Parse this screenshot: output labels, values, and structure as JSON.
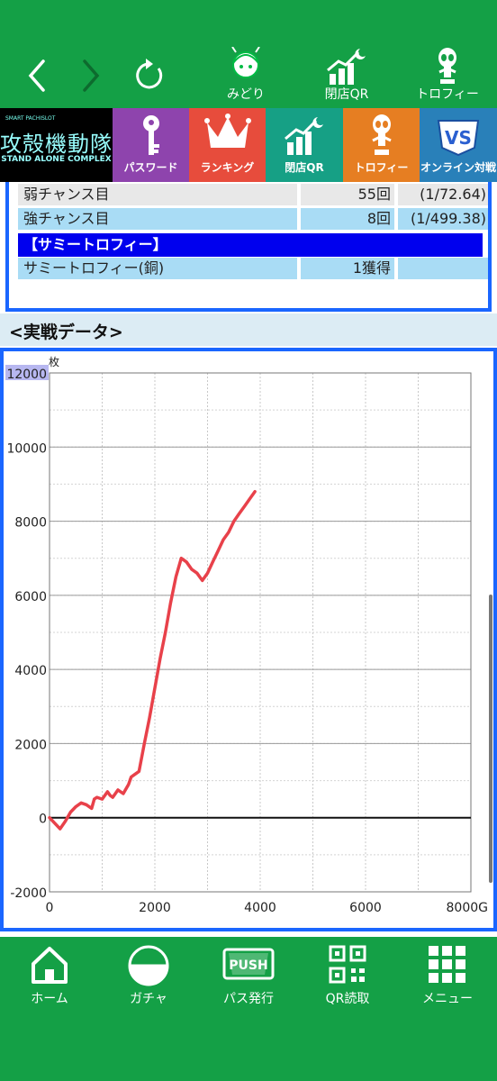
{
  "topnav": {
    "items": [
      {
        "label": "みどり",
        "icon": "girl-character-icon"
      },
      {
        "label": "閉店QR",
        "icon": "chart-qr-icon"
      },
      {
        "label": "トロフィー",
        "icon": "trophy-alien-icon"
      }
    ]
  },
  "banner": {
    "logo": {
      "small": "SMART PACHISLOT",
      "title": "攻殻機動隊",
      "subtitle": "STAND ALONE COMPLEX"
    },
    "tiles": [
      {
        "label": "パスワード",
        "icon": "key-icon",
        "color": "#8e44ad"
      },
      {
        "label": "ランキング",
        "icon": "crown-icon",
        "color": "#e74c3c"
      },
      {
        "label": "閉店QR",
        "icon": "chart-qr-icon",
        "color": "#16a085"
      },
      {
        "label": "トロフィー",
        "icon": "trophy-alien-icon",
        "color": "#e67e22"
      },
      {
        "label": "オンライン対戦",
        "icon": "vs-online-icon",
        "color": "#2980b9"
      }
    ]
  },
  "stats": {
    "rows": [
      {
        "name": "弱チャンス目",
        "count": "55回",
        "prob": "(1/72.64)"
      },
      {
        "name": "強チャンス目",
        "count": "8回",
        "prob": "(1/499.38)"
      }
    ],
    "section_header": "【サミートロフィー】",
    "trophy_row": {
      "name": "サミートロフィー(銅)",
      "count": "1獲得",
      "prob": ""
    }
  },
  "section_title": "<実戦データ>",
  "chart_data": {
    "type": "line",
    "y_unit": "枚",
    "x_unit": "G",
    "xlim": [
      0,
      8000
    ],
    "ylim": [
      -2000,
      12000
    ],
    "x_ticks": [
      0,
      2000,
      4000,
      6000,
      8000
    ],
    "x_tick_labels": [
      "0",
      "2000",
      "4000",
      "6000",
      "8000G"
    ],
    "y_ticks": [
      12000,
      10000,
      8000,
      6000,
      4000,
      2000,
      0,
      -2000
    ],
    "y_tick_labels": [
      "12000",
      "10000",
      "8000",
      "6000",
      "4000",
      "2000",
      "0",
      "-2000"
    ],
    "grid": true,
    "series": [
      {
        "color": "#e8414a",
        "x": [
          0,
          100,
          200,
          300,
          400,
          500,
          600,
          700,
          800,
          850,
          900,
          1000,
          1100,
          1150,
          1200,
          1300,
          1400,
          1500,
          1550,
          1600,
          1700,
          1800,
          1900,
          2000,
          2100,
          2200,
          2300,
          2400,
          2500,
          2600,
          2700,
          2800,
          2900,
          3000,
          3100,
          3200,
          3300,
          3400,
          3500,
          3600,
          3700,
          3800,
          3900
        ],
        "y": [
          0,
          -150,
          -300,
          -100,
          150,
          300,
          400,
          350,
          250,
          500,
          550,
          500,
          700,
          600,
          550,
          750,
          650,
          900,
          1100,
          1150,
          1250,
          2000,
          2700,
          3500,
          4300,
          5000,
          5800,
          6500,
          7000,
          6900,
          6700,
          6600,
          6400,
          6600,
          6900,
          7200,
          7500,
          7700,
          8000,
          8200,
          8400,
          8600,
          8800
        ]
      }
    ]
  },
  "bottomnav": {
    "items": [
      {
        "label": "ホーム",
        "icon": "home-icon"
      },
      {
        "label": "ガチャ",
        "icon": "gacha-ball-icon"
      },
      {
        "label": "パス発行",
        "icon": "push-pass-icon"
      },
      {
        "label": "QR読取",
        "icon": "qr-code-icon"
      },
      {
        "label": "メニュー",
        "icon": "menu-grid-icon"
      }
    ]
  }
}
